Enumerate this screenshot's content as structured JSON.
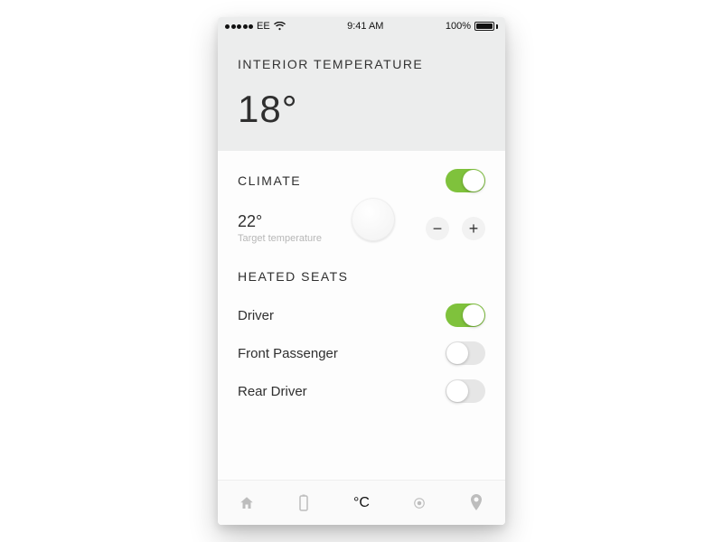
{
  "statusbar": {
    "carrier": "EE",
    "time": "9:41 AM",
    "battery_pct": "100%"
  },
  "header": {
    "title": "INTERIOR TEMPERATURE",
    "current_temp": "18°"
  },
  "climate": {
    "heading": "CLIMATE",
    "enabled": true,
    "target_temp": "22°",
    "target_sub": "Target temperature",
    "minus_label": "−",
    "plus_label": "+"
  },
  "heated_seats": {
    "heading": "HEATED SEATS",
    "items": [
      {
        "label": "Driver",
        "on": true
      },
      {
        "label": "Front Passenger",
        "on": false
      },
      {
        "label": "Rear Driver",
        "on": false
      }
    ]
  },
  "nav": {
    "temp_label": "°C"
  }
}
